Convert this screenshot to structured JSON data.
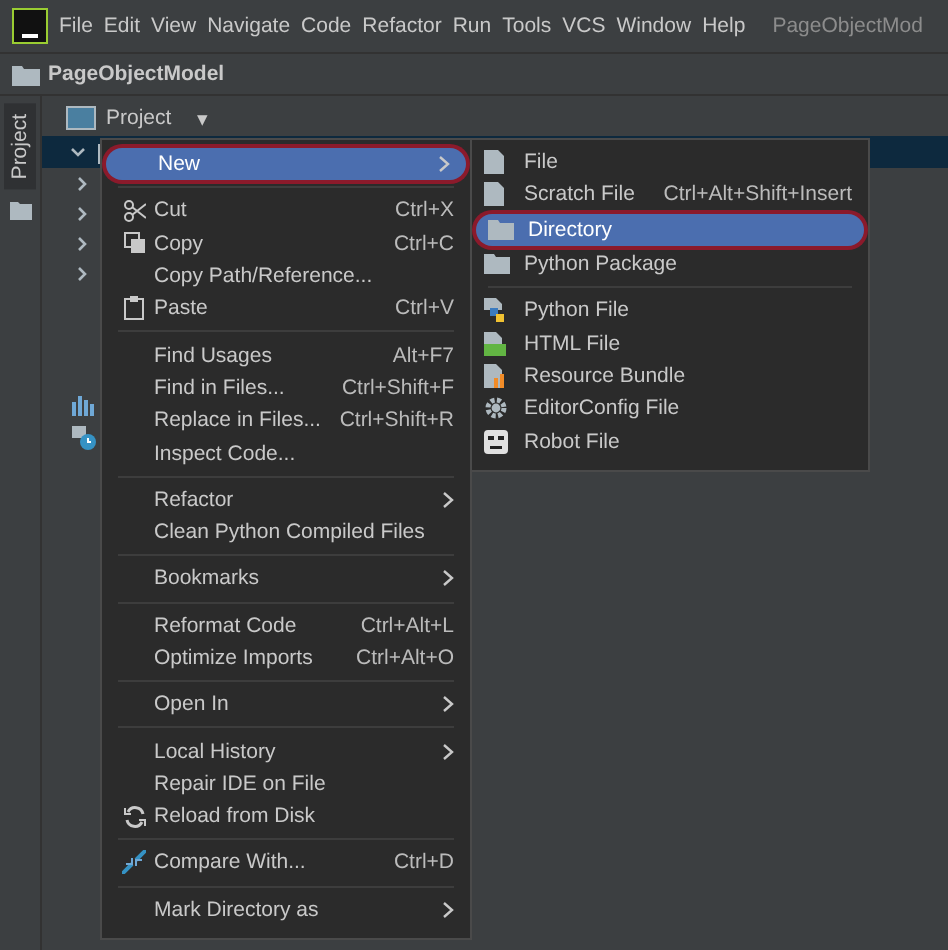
{
  "menu_bar": {
    "items": [
      "File",
      "Edit",
      "View",
      "Navigate",
      "Code",
      "Refactor",
      "Run",
      "Tools",
      "VCS",
      "Window",
      "Help"
    ],
    "title": "PageObjectMod"
  },
  "breadcrumb": "PageObjectModel",
  "side_tab": {
    "label": "Project",
    "selected": true
  },
  "project_toolbar": {
    "label": "Project",
    "caret": "▾"
  },
  "tree": [
    {
      "expanded": true,
      "selected": true
    },
    {
      "expanded": false,
      "selected": false
    },
    {
      "expanded": false,
      "selected": false
    },
    {
      "expanded": false,
      "selected": false
    },
    {
      "expanded": false,
      "selected": false
    }
  ],
  "context_menu": {
    "groups": [
      [
        {
          "label": "New",
          "submenu": true,
          "selected": true,
          "annotated": true
        }
      ],
      [
        {
          "label": "Cut",
          "shortcut": "Ctrl+X",
          "submenu": false,
          "selected": false,
          "annotated": false
        },
        {
          "label": "Copy",
          "shortcut": "Ctrl+C",
          "submenu": false,
          "selected": false,
          "annotated": false
        },
        {
          "label": "Copy Path/Reference...",
          "submenu": false,
          "selected": false,
          "annotated": false
        },
        {
          "label": "Paste",
          "shortcut": "Ctrl+V",
          "submenu": false,
          "selected": false,
          "annotated": false
        }
      ],
      [
        {
          "label": "Find Usages",
          "shortcut": "Alt+F7",
          "submenu": false,
          "selected": false,
          "annotated": false
        },
        {
          "label": "Find in Files...",
          "shortcut": "Ctrl+Shift+F",
          "submenu": false,
          "selected": false,
          "annotated": false
        },
        {
          "label": "Replace in Files...",
          "shortcut": "Ctrl+Shift+R",
          "submenu": false,
          "selected": false,
          "annotated": false
        },
        {
          "label": "Inspect Code...",
          "submenu": false,
          "selected": false,
          "annotated": false
        }
      ],
      [
        {
          "label": "Refactor",
          "submenu": true,
          "selected": false,
          "annotated": false
        },
        {
          "label": "Clean Python Compiled Files",
          "submenu": false,
          "selected": false,
          "annotated": false
        }
      ],
      [
        {
          "label": "Bookmarks",
          "submenu": true,
          "selected": false,
          "annotated": false
        }
      ],
      [
        {
          "label": "Reformat Code",
          "shortcut": "Ctrl+Alt+L",
          "submenu": false,
          "selected": false,
          "annotated": false
        },
        {
          "label": "Optimize Imports",
          "shortcut": "Ctrl+Alt+O",
          "submenu": false,
          "selected": false,
          "annotated": false
        }
      ],
      [
        {
          "label": "Open In",
          "submenu": true,
          "selected": false,
          "annotated": false
        }
      ],
      [
        {
          "label": "Local History",
          "submenu": true,
          "selected": false,
          "annotated": false
        },
        {
          "label": "Repair IDE on File",
          "submenu": false,
          "selected": false,
          "annotated": false
        },
        {
          "label": "Reload from Disk",
          "submenu": false,
          "selected": false,
          "annotated": false
        }
      ],
      [
        {
          "label": "Compare With...",
          "shortcut": "Ctrl+D",
          "submenu": false,
          "selected": false,
          "annotated": false
        }
      ],
      [
        {
          "label": "Mark Directory as",
          "submenu": true,
          "selected": false,
          "annotated": false
        }
      ]
    ]
  },
  "submenu": {
    "groups": [
      [
        {
          "label": "File",
          "selected": false,
          "annotated": false
        },
        {
          "label": "Scratch File",
          "shortcut": "Ctrl+Alt+Shift+Insert",
          "selected": false,
          "annotated": false
        },
        {
          "label": "Directory",
          "selected": true,
          "annotated": true
        },
        {
          "label": "Python Package",
          "selected": false,
          "annotated": false
        }
      ],
      [
        {
          "label": "Python File",
          "selected": false,
          "annotated": false
        },
        {
          "label": "HTML File",
          "selected": false,
          "annotated": false
        },
        {
          "label": "Resource Bundle",
          "selected": false,
          "annotated": false
        },
        {
          "label": "EditorConfig File",
          "selected": false,
          "annotated": false
        },
        {
          "label": "Robot File",
          "selected": false,
          "annotated": false
        }
      ]
    ]
  }
}
